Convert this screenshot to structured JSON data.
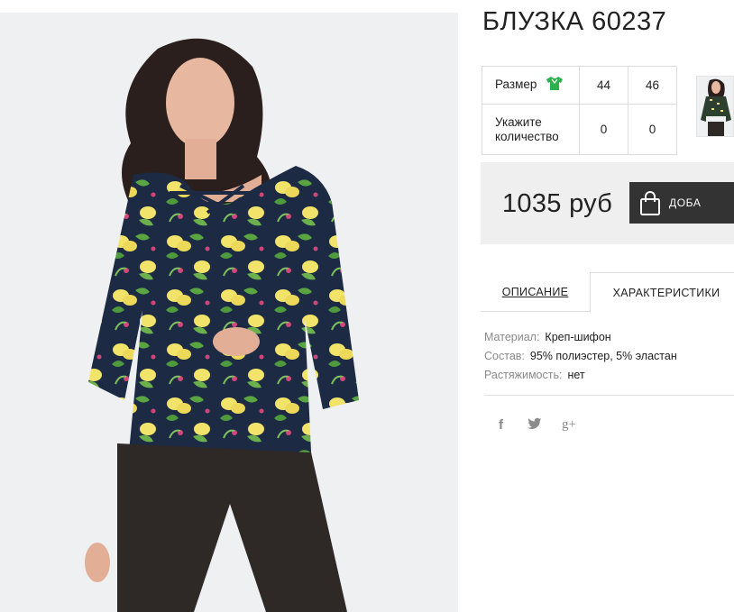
{
  "product": {
    "title": "БЛУЗКА 60237"
  },
  "sizes_table": {
    "size_label": "Размер",
    "size_icon": "green-shirt-icon",
    "qty_label_line1": "Укажите",
    "qty_label_line2": "количество",
    "sizes": [
      "44",
      "46"
    ],
    "quantities": [
      "0",
      "0"
    ]
  },
  "purchase": {
    "price": "1035 руб",
    "add_button_label": "ДОБА",
    "button_icon": "shopping-bag-icon"
  },
  "tabs": {
    "description": "ОПИСАНИЕ",
    "characteristics": "ХАРАКТЕРИСТИКИ",
    "active": "characteristics"
  },
  "characteristics": [
    {
      "label": "Материал:",
      "value": "Креп-шифон"
    },
    {
      "label": "Состав:",
      "value": "95% полиэстер, 5% эластан"
    },
    {
      "label": "Растяжимость:",
      "value": "нет"
    }
  ],
  "social": {
    "facebook": "f",
    "twitter_icon": "twitter-icon",
    "googleplus": "g+"
  },
  "colors": {
    "button_bg": "#333333",
    "price_panel_bg": "#efefef",
    "size_icon_color": "#2bb24c",
    "blouse_navy": "#1c2a44",
    "lemon_yellow": "#f2e46a",
    "leaf_green": "#4f9a3c"
  }
}
